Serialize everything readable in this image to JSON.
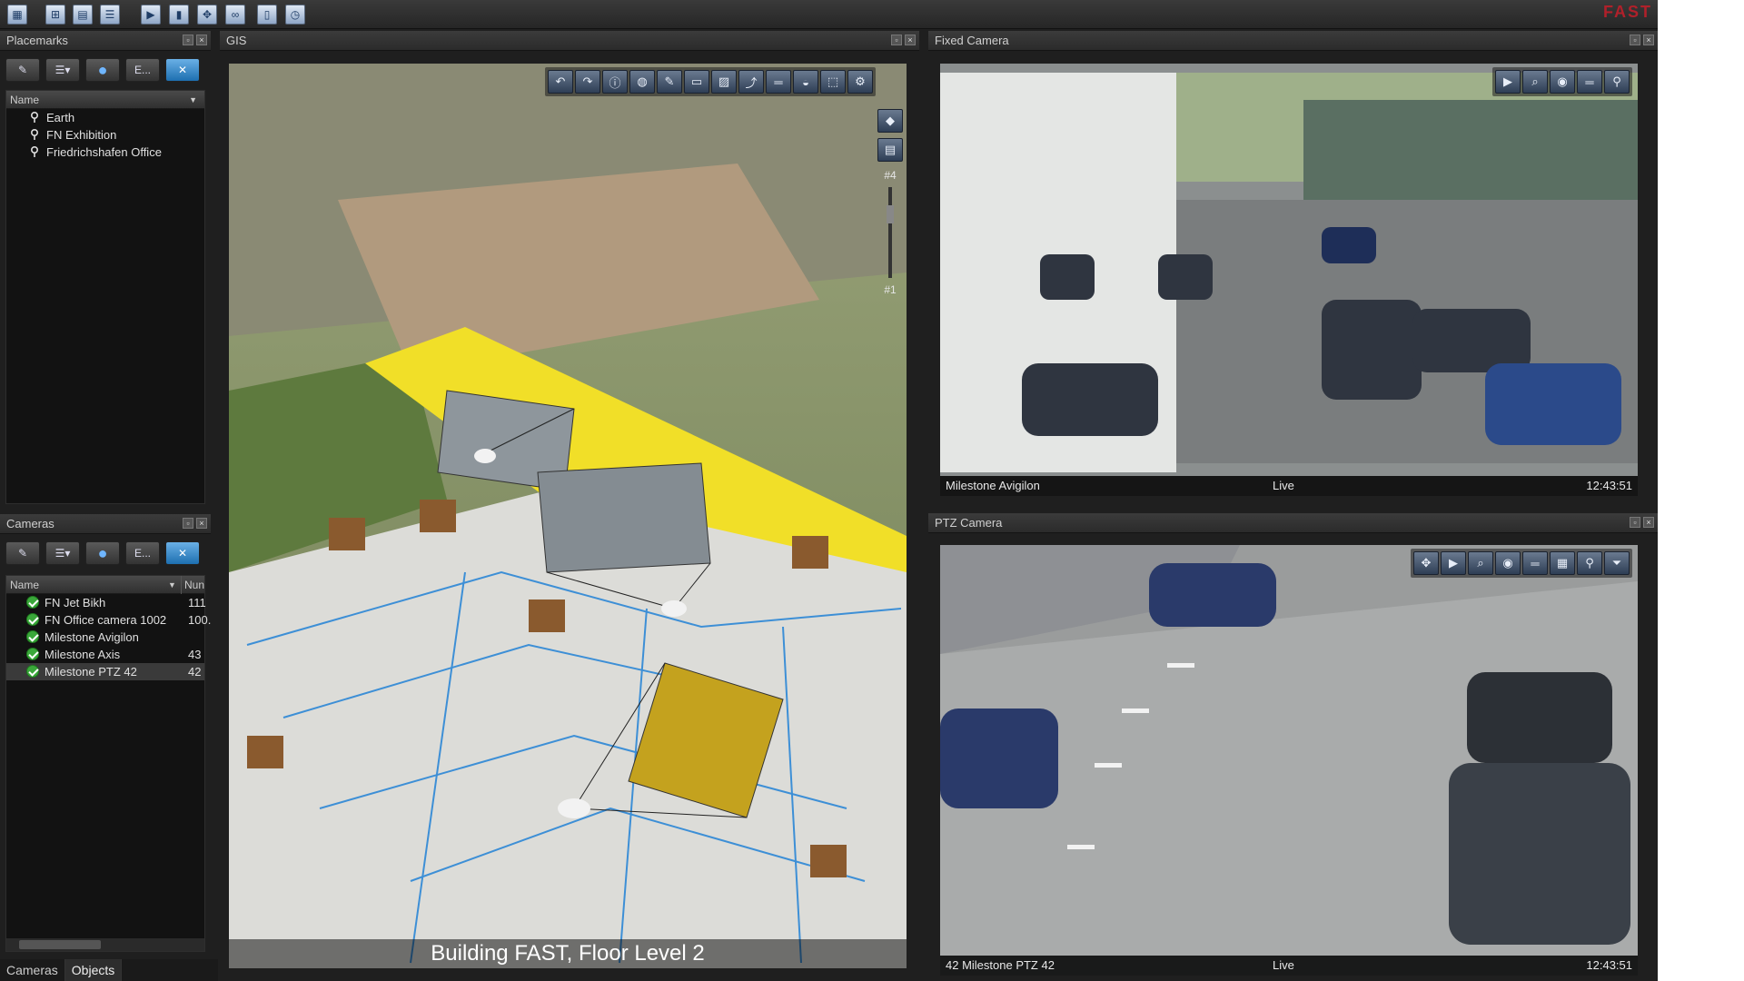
{
  "app": {
    "brand": "FAST"
  },
  "toolbar": {
    "icons": [
      "layout-icon",
      "grid-add-icon",
      "grid-icon",
      "list-add-icon",
      "play-icon",
      "device-icon",
      "move-icon",
      "binoculars-icon",
      "page-icon",
      "clock-icon"
    ]
  },
  "placemarks": {
    "title": "Placemarks",
    "tool_label_e": "E...",
    "column": "Name",
    "items": [
      "Earth",
      "FN Exhibition",
      "Friedrichshafen Office"
    ]
  },
  "cameras": {
    "title": "Cameras",
    "tool_label_e": "E...",
    "columns": [
      "Name",
      "Nun"
    ],
    "items": [
      {
        "name": "FN Jet Bikh",
        "num": "111"
      },
      {
        "name": "FN Office camera 1002",
        "num": "100."
      },
      {
        "name": "Milestone Avigilon",
        "num": ""
      },
      {
        "name": "Milestone Axis",
        "num": "43"
      },
      {
        "name": "Milestone PTZ 42",
        "num": "42"
      }
    ]
  },
  "tabs": [
    "Cameras",
    "Objects"
  ],
  "gis": {
    "title": "GIS",
    "caption": "Building FAST, Floor Level 2",
    "level_top": "#4",
    "level_bottom": "#1"
  },
  "fixed_camera": {
    "title": "Fixed Camera",
    "name": "Milestone Avigilon",
    "mode": "Live",
    "time": "12:43:51"
  },
  "ptz_camera": {
    "title": "PTZ Camera",
    "name": "42 Milestone PTZ 42",
    "mode": "Live",
    "time": "12:43:51"
  },
  "colors": {
    "background": "#1f1f1f",
    "accent_blue": "#3d8fd6",
    "status_green": "#3aa83a",
    "highlight_yellow": "#f4e31c",
    "brand_red": "#b0202a"
  }
}
